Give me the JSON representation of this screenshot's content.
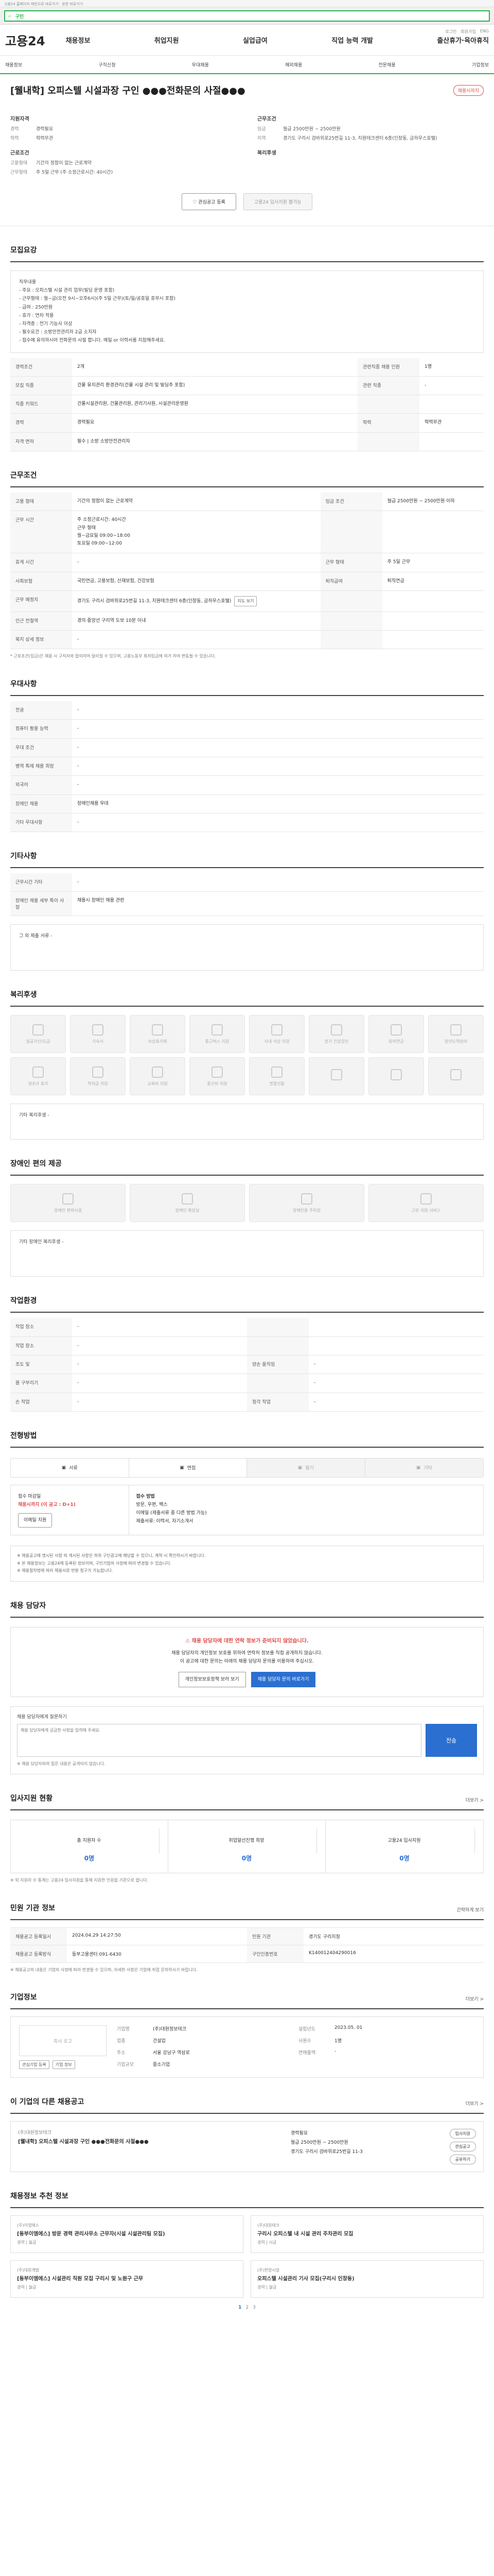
{
  "topline": "고용24 홈페이지 메인으로 바로가기 · 본문 바로가기",
  "search": {
    "label": "구인",
    "placeholder": ""
  },
  "site": {
    "logo": "고용24",
    "toplinks": [
      "로그인",
      "회원가입",
      "ENG"
    ]
  },
  "menu": [
    "채용정보",
    "취업지원",
    "실업급여",
    "직업 능력 개발",
    "출산휴가·육아휴직"
  ],
  "subnav": [
    "채용정보",
    "구직신청",
    "우대채용",
    "해외채용",
    "전문채용",
    "기업정보"
  ],
  "job": {
    "title": "[웰내학] 오피스텔 시설과장 구인 ●●●전화문의 사절●●●",
    "apply_badge": "채용시까지"
  },
  "summary": {
    "left_title": "지원자격",
    "left": [
      {
        "k": "경력",
        "v": "경력필요"
      },
      {
        "k": "학력",
        "v": "학력무관"
      }
    ],
    "left2_title": "근로조건",
    "left2": [
      {
        "k": "고용형태",
        "v": "기간의 정함이 없는 근로계약"
      },
      {
        "k": "근무형태",
        "v": "주 5일 근무 (주 소정근로시간: 40시간)"
      }
    ],
    "right_title": "근무조건",
    "right": [
      {
        "k": "임금",
        "v": "월급 2500만원 ~ 2500만원"
      },
      {
        "k": "지역",
        "v": "경기도 구리시 검바위로25번길 11-3, 지원테크센터 6층(인창동, 금하우스호텔)"
      }
    ],
    "right2_title": "복리후생"
  },
  "buttons": {
    "interest": "관심공고 등록",
    "apply": "고용24 입사지원 불가능"
  },
  "sec_recruit": {
    "title": "모집요강",
    "text": "직무내용\n- 주요 : 오피스텔 시설 관리 업무(빌딩 운영 포함)\n- 근무형태 : 월~금(오전 9시~오후6시)(주 5일 근무)(토/일/공휴일 휴무시 포함)\n- 급여 : 250만원\n- 휴가 : 연차 적용\n- 자격증 : 전기 기능사 이상\n- 필수요건 : 소방안전관리자 2급 소지자\n- 접수에 유의하시어 전화문의 사절 합니다. 메일 or 이력서를 지참해주세요.",
    "rows": [
      {
        "h": "경력조건",
        "v": "2개",
        "h2": "관련직종 채용 인원",
        "v2": "1명"
      },
      {
        "h": "모집 직종",
        "v": "건물 유지관리 환경관리(건물 시설 관리 및 빌딩주 포함)",
        "h2": "관련 직종",
        "v2": "-"
      },
      {
        "h": "직종 키워드",
        "v": "건물시설관리원, 건물관리원, 관리기사원, 시설관리운영원",
        "h2": "",
        "v2": ""
      },
      {
        "h": "경력",
        "v": "경력필요",
        "h2": "학력",
        "v2": "학력무관"
      },
      {
        "h": "자격 면허",
        "v": "필수 | 소방 소방안전관리자",
        "h2": "",
        "v2": ""
      }
    ]
  },
  "sec_cond": {
    "title": "근무조건",
    "rows": [
      {
        "h": "고용 형태",
        "v": "기간의 정함이 없는 근로계약",
        "h2": "임금 조건",
        "v2": "월급 2500만원 ~ 2500만원 이하"
      },
      {
        "h": "근무 시간",
        "v": "주 소정근로시간: 40시간\n근무 형태\n월~금요일 09:00~18:00\n토요일 09:00~12:00",
        "h2": "",
        "v2": ""
      },
      {
        "h": "휴게 시간",
        "v": "-",
        "h2": "근무 형태",
        "v2": "주 5일 근무"
      },
      {
        "h": "사회보험",
        "v": "국민연금, 고용보험, 산재보험, 건강보험",
        "h2": "퇴직급여",
        "v2": "퇴직연금"
      },
      {
        "h": "근무 예정지",
        "v": "경기도 구리시 검바위로25번길 11-3, 지원테크센터 6층(인창동, 금하우스호텔)",
        "h2": "",
        "v2": "",
        "btn": "지도 보기"
      },
      {
        "h": "인근 전철역",
        "v": "경의·중앙선 구리역 도보 10분 이내",
        "h2": "",
        "v2": ""
      },
      {
        "h": "복지 상세 정보",
        "v": "-",
        "h2": "",
        "v2": ""
      }
    ],
    "note": "* 근로조건(임금)은 채용 시 구직자와 합의하여 달라질 수 있으며, 고용노동부 최저임금에 의거 하여 변동될 수 있습니다."
  },
  "sec_pref": {
    "title": "우대사항",
    "rows": [
      {
        "h": "전공",
        "v": "-"
      },
      {
        "h": "컴퓨터 활용 능력",
        "v": "-"
      },
      {
        "h": "우대 조건",
        "v": "-"
      },
      {
        "h": "병역 특례 채용 희망",
        "v": "-"
      },
      {
        "h": "외국어",
        "v": "-"
      },
      {
        "h": "장애인 채용",
        "v": "장애인채용 우대"
      },
      {
        "h": "기타 우대사항",
        "v": "-"
      }
    ]
  },
  "sec_etc": {
    "title": "기타사항",
    "rows": [
      {
        "h": "근무시간 기타",
        "v": "-"
      },
      {
        "h": "장애인 채용 세부 특이 사항",
        "v": "채용시 장애인 채용 관련"
      }
    ],
    "box": "그 외 제출 서류 -"
  },
  "sec_welfare": {
    "title": "복리후생",
    "tags": [
      "일공가산/도급",
      "기숙사",
      "보상휴가제",
      "통근버스 지원",
      "사내 식당 지원",
      "정기 건강검진",
      "퇴직연금",
      "청년도약장려",
      "경조사 휴가",
      "학자금 지원",
      "교육비 지원",
      "통신비 지원",
      "명절선물",
      "",
      "",
      ""
    ],
    "box": "기타 복리후생 -"
  },
  "sec_disabled": {
    "title": "장애인 편의 제공",
    "tags": [
      "장애인 편의시설",
      "장애인 화장실",
      "장애인용 주차장",
      "근로 지원 서비스"
    ],
    "box": "기타 장애인 복리후생 -"
  },
  "sec_workenv": {
    "title": "작업환경",
    "rows": [
      {
        "h": "작업 장소",
        "v": "-",
        "h2": "",
        "v2": ""
      },
      {
        "h": "작업 장소",
        "v": "-",
        "h2": "",
        "v2": ""
      },
      {
        "h": "조도 및",
        "v": "-",
        "h2": "양손 움직임",
        "v2": "-"
      },
      {
        "h": "몸 구부리기",
        "v": "-",
        "h2": "",
        "v2": "-"
      },
      {
        "h": "손 작업",
        "v": "-",
        "h2": "청각 작업",
        "v2": "-"
      }
    ]
  },
  "sec_flow": {
    "title": "전형방법",
    "steps": [
      "서류",
      "면접",
      "필기",
      "기타"
    ],
    "left_title": "접수 마감일",
    "left_val": "채용시까지 (이 공고 : D+1)",
    "left_btn": "이메일 지원",
    "right_title": "접수 방법",
    "right": "방문, 우편, 팩스\n이메일 (제출서류 중 다른 방법 가능)",
    "docs": "제출서류: 이력서, 자기소개서",
    "rules": "※ 채용공고에 명시된 사항 외 게시된 사항은 허위 구인광고에 해당할 수 있으니, 계약 시 확인하시기 바랍니다.\n※ 본 채용정보는 고용24에 등록된 정보이며, 구인기업의 사정에 따라 변경될 수 있습니다.\n※ 채용절차법에 따라 채용서류 반환 청구가 가능합니다."
  },
  "sec_contact": {
    "title": "채용 담당자",
    "alert_title": "채용 담당자에 대한 연락 정보가 준비되지 않았습니다.",
    "alert_text": "채용 담당자의 개인정보 보호를 위하여 연락처 정보를 직접 공개하지 않습니다.\n이 공고에 대한 문의는 아래의 채용 담당자 문의를 이용하여 주십시오.",
    "btn1": "개인정보보호정책 보러 보기",
    "btn2": "채용 담당자 문의 바로가기",
    "qa_head": "채용 담당자에게 질문하기",
    "qa_placeholder": "채용 담당자에게 궁금한 사항을 입력해 주세요.",
    "qa_btn": "전송",
    "qa_note": "※ 채용 담당자와의 질문 내용은 공개되지 않습니다."
  },
  "sec_stats": {
    "title": "입사지원 현황",
    "more": "더보기 >",
    "items": [
      {
        "l": "총 지원자 수",
        "v": "0명"
      },
      {
        "l": "취업알선진행 희망",
        "v": "0명"
      },
      {
        "l": "고용24 입사지원",
        "v": "0명"
      }
    ],
    "note": "※ 위 지원자 수 통계는 고용24 입사지원을 통해 지원한 인원을 기준으로 합니다."
  },
  "sec_info": {
    "title": "민원 기관 정보",
    "btn": "간략하게 보기",
    "cells": [
      {
        "h": "채용공고 등록일시",
        "v": "2024.04.29 14:27:50"
      },
      {
        "h": "민원 기관",
        "v": "경기도 구리지청"
      },
      {
        "h": "채용공고 등록방식",
        "v": "동부고용센터 091-6430"
      },
      {
        "h": "구인인증번호",
        "v": "K140012404290016"
      }
    ],
    "note": "※ 채용공고의 내용은 기업의 사정에 따라 변경될 수 있으며, 자세한 사항은 기업에 직접 문의하시기 바랍니다."
  },
  "sec_company": {
    "title": "기업정보",
    "more": "더보기 >",
    "logo": "회사 로고",
    "btn1": "관심기업 등록",
    "btn2": "기업 정보",
    "cells": [
      {
        "h": "기업명",
        "v": "(주)대원정보테크"
      },
      {
        "h": "설립년도",
        "v": "2023.05. 01"
      },
      {
        "h": "업종",
        "v": "건설업"
      },
      {
        "h": "사원수",
        "v": "1명"
      },
      {
        "h": "주소",
        "v": "서울 강남구 역삼로"
      },
      {
        "h": "연매출액",
        "v": "-"
      },
      {
        "h": "기업규모",
        "v": "중소기업"
      },
      {
        "h": "",
        "v": ""
      }
    ]
  },
  "sec_similar": {
    "title": "이 기업의 다른 채용공고",
    "more": "더보기 >",
    "company": "(주)대원정보테크",
    "jobtitle": "[웰내학] 오피스텔 시설과장 구인 ●●●전화문의 사절●●●",
    "details": [
      "경력필요",
      "월급 2500만원 ~ 2500만원",
      "경기도 구리시 검바위로25번길 11-3"
    ],
    "acts": [
      "입사지원",
      "관심공고",
      "공유하기"
    ]
  },
  "sec_recommend": {
    "title": "채용정보 추천 정보",
    "cards": [
      {
        "company": "(주)이엠에스",
        "title": "[동부이엠에스] 방문 경력 관리사무소 근무자(시설 시설관리팀 모집)",
        "info": "경력 | 월급"
      },
      {
        "company": "(주)대원테크",
        "title": "구리시 오피스텔 내 시설 관리 주차관리 모집",
        "info": "경력 | 시급"
      },
      {
        "company": "(주)대원개발",
        "title": "[동부이엠에스] 시설관리 직원 모집 구리시 및 노원구 근무",
        "info": "경력 | 월급"
      },
      {
        "company": "(주)한양시설",
        "title": "오피스텔 시설관리 기사 모집(구리시 인창동)",
        "info": "경력 | 월급"
      }
    ],
    "pages": [
      "1",
      "2",
      "3"
    ]
  }
}
